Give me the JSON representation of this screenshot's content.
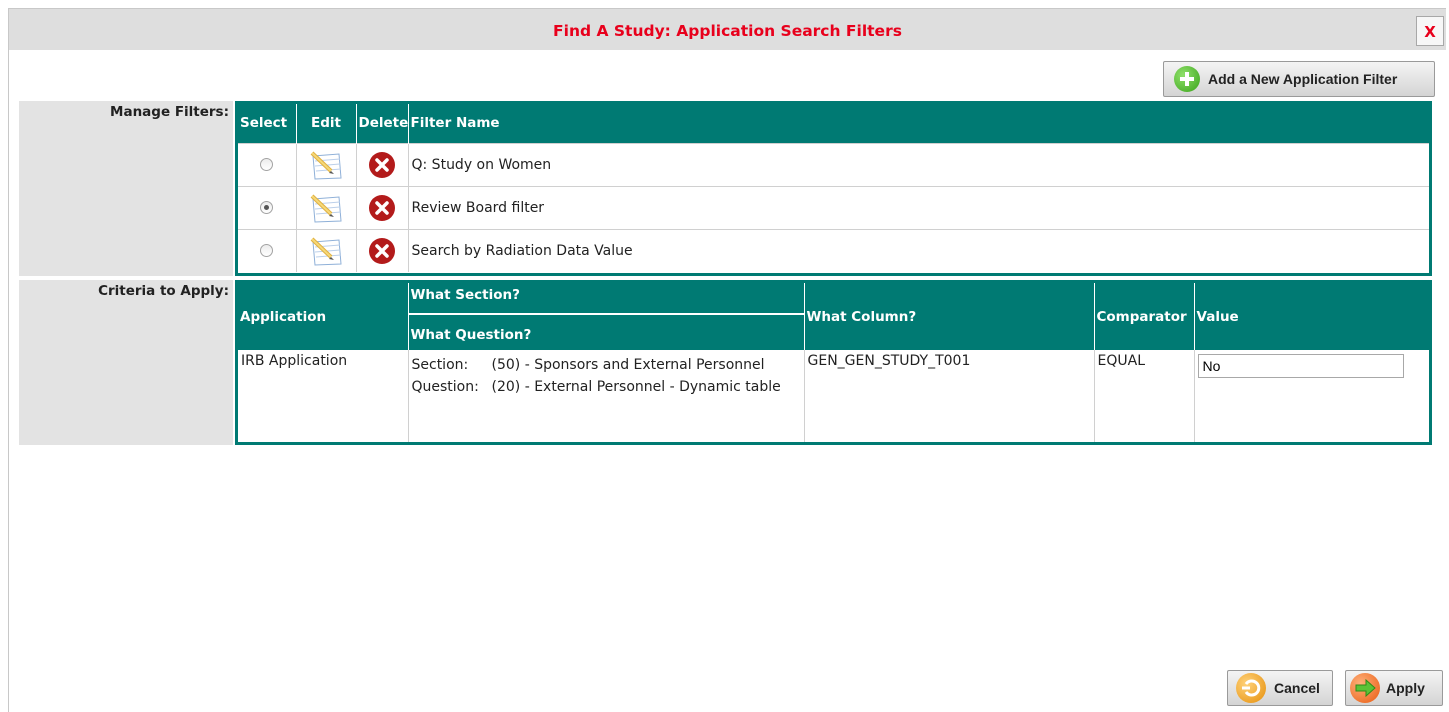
{
  "dialog": {
    "title": "Find A Study: Application Search Filters",
    "close_label": "X",
    "add_filter_label": "Add a New Application Filter"
  },
  "manage_filters": {
    "section_label": "Manage Filters:",
    "headers": {
      "select": "Select",
      "edit": "Edit",
      "delete": "Delete",
      "filter_name": "Filter Name"
    },
    "rows": [
      {
        "name": "Q: Study on Women",
        "selected": false
      },
      {
        "name": "Review Board filter",
        "selected": true
      },
      {
        "name": "Search by Radiation Data Value",
        "selected": false
      }
    ]
  },
  "criteria": {
    "section_label": "Criteria to Apply:",
    "headers": {
      "application": "Application",
      "what_section": "What Section?",
      "what_question": "What Question?",
      "what_column": "What Column?",
      "comparator": "Comparator",
      "value": "Value"
    },
    "row": {
      "application": "IRB Application",
      "section_key": "Section:",
      "section_value": "(50) - Sponsors and External Personnel",
      "question_key": "Question:",
      "question_value": "(20) - External Personnel - Dynamic table",
      "column": "GEN_GEN_STUDY_T001",
      "comparator": "EQUAL",
      "value": "No"
    }
  },
  "footer": {
    "cancel_label": "Cancel",
    "apply_label": "Apply"
  },
  "icons": {
    "add": "plus-circle-icon",
    "edit": "notepad-pencil-icon",
    "delete": "red-x-circle-icon",
    "cancel": "undo-arrow-icon",
    "apply": "right-arrow-icon"
  },
  "colors": {
    "title": "#e8001c",
    "header_teal": "#007a73",
    "label_bg": "#e3e3e3",
    "delete_red": "#b31b1b"
  }
}
